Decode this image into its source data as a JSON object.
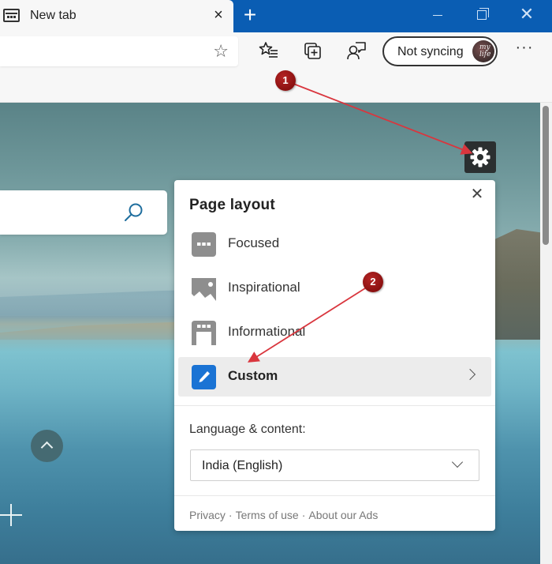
{
  "browser": {
    "tab": {
      "title": "New tab",
      "close_glyph": "×",
      "icon": "new-tab-page-icon"
    },
    "new_tab_glyph": "+",
    "window_controls": {
      "close_glyph": "✕"
    },
    "toolbar": {
      "favorite_star_glyph": "☆",
      "sync_label": "Not syncing",
      "avatar_text": "my life",
      "more_glyph": "···",
      "icons": [
        "add-favorite-icon",
        "favorites-icon",
        "collections-icon",
        "feedback-icon"
      ]
    }
  },
  "new_tab_page": {
    "settings_icon": "gear-icon",
    "search_icon": "search-icon",
    "scroll_up_icon": "chevron-up-icon",
    "add_shortcut_icon": "plus-icon"
  },
  "panel": {
    "title": "Page layout",
    "close_glyph": "✕",
    "layout_options": [
      {
        "label": "Focused",
        "icon": "focused-layout-icon",
        "selected": false
      },
      {
        "label": "Inspirational",
        "icon": "inspirational-layout-icon",
        "selected": false
      },
      {
        "label": "Informational",
        "icon": "informational-layout-icon",
        "selected": false
      },
      {
        "label": "Custom",
        "icon": "pencil-icon",
        "selected": true
      }
    ],
    "language_label": "Language & content:",
    "language_value": "India (English)",
    "footer": {
      "links": [
        "Privacy",
        "Terms of use",
        "About our Ads"
      ],
      "separator": "·"
    }
  },
  "annotations": {
    "step1": "1",
    "step2": "2",
    "arrow_color": "#d9363e"
  }
}
